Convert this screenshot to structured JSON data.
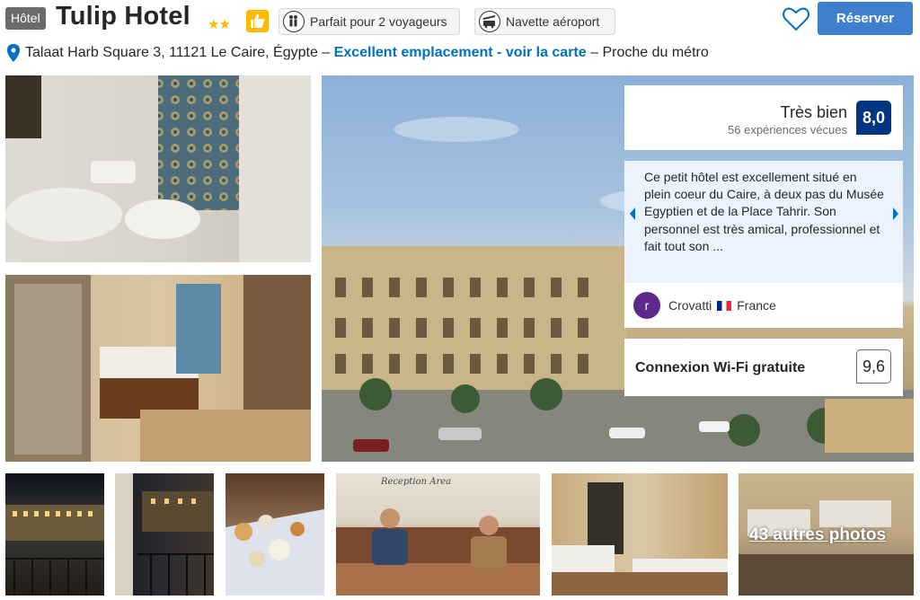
{
  "header": {
    "type_badge": "Hôtel",
    "hotel_name": "Tulip Hotel",
    "stars": "★★",
    "star_count": 2,
    "facilities": [
      {
        "label": "Parfait pour 2 voyageurs",
        "icon": "travelers-icon"
      },
      {
        "label": "Navette aéroport",
        "icon": "shuttle-icon"
      }
    ],
    "reserve_label": "Réserver"
  },
  "address": {
    "street": "Talaat Harb Square 3, 11121 Le Caire, Égypte –",
    "link_text": "Excellent emplacement - voir la carte",
    "suffix": "– Proche du métro"
  },
  "review_panel": {
    "rating_label": "Très bien",
    "experiences": "56 expériences vécues",
    "score": "8,0",
    "review_text": "Ce petit hôtel est excellement situé en plein coeur du Caire, à deux pas du Musée Egyptien et de la Place Tahrir. Son personnel est très amical, professionnel et fait tout son ...",
    "reviewer_initial": "r",
    "reviewer_name": "Crovatti",
    "reviewer_country": "France",
    "wifi_label": "Connexion Wi-Fi gratuite",
    "wifi_score": "9,6"
  },
  "gallery": {
    "reception_caption": "Reception Area",
    "more_photos": "43 autres photos"
  },
  "colors": {
    "brand_blue": "#003580",
    "button_blue": "#3f80ce",
    "link_blue": "#0071c2",
    "star_yellow": "#febb02",
    "review_bg": "#ebf3ff"
  }
}
